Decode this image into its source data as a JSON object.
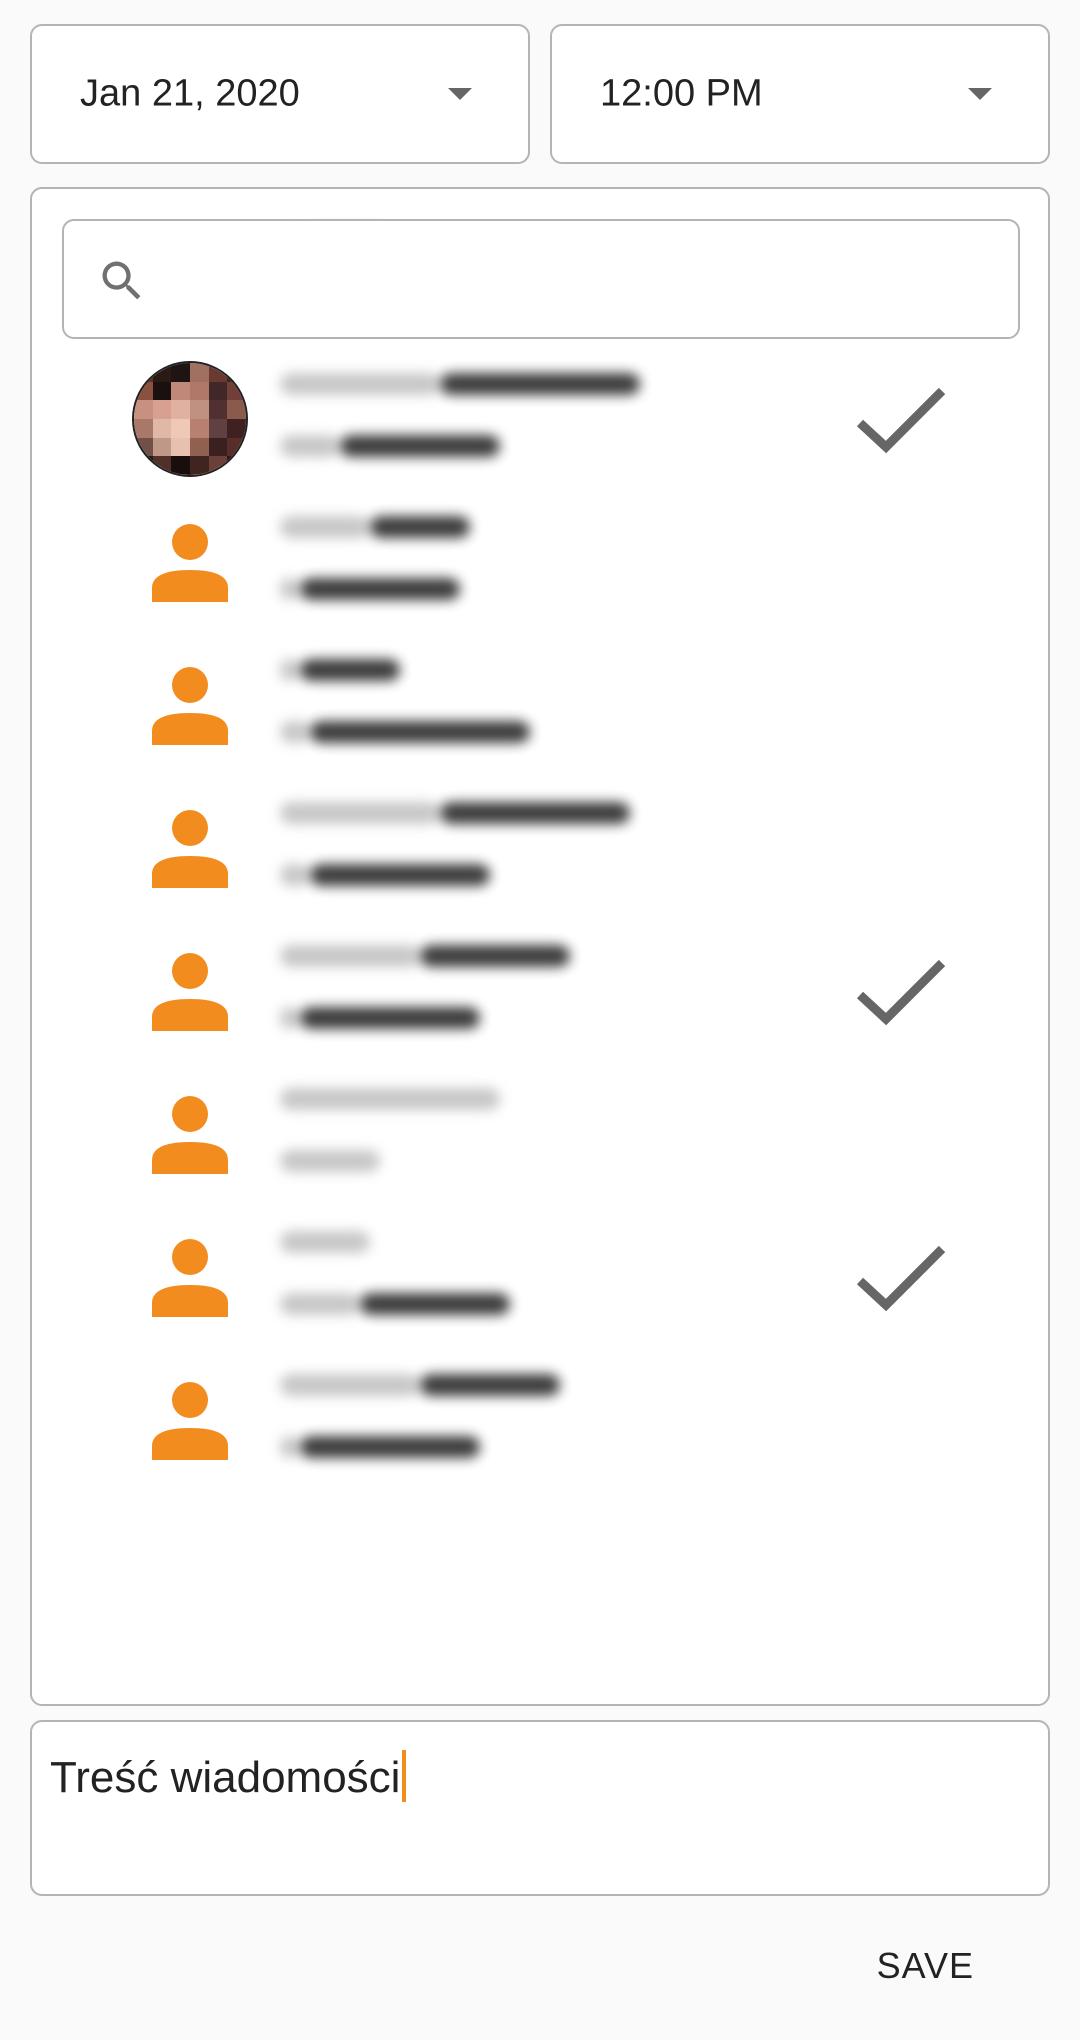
{
  "date_picker": {
    "value": "Jan 21, 2020"
  },
  "time_picker": {
    "value": "12:00 PM"
  },
  "search": {
    "placeholder": ""
  },
  "contacts": [
    {
      "avatar": "person-icon",
      "selected": false
    },
    {
      "avatar": "person-icon",
      "selected": false
    },
    {
      "avatar": "photo",
      "selected": true
    },
    {
      "avatar": "person-icon",
      "selected": false
    },
    {
      "avatar": "person-icon",
      "selected": false
    },
    {
      "avatar": "person-icon",
      "selected": false
    },
    {
      "avatar": "person-icon",
      "selected": true
    },
    {
      "avatar": "person-icon",
      "selected": false
    },
    {
      "avatar": "person-icon",
      "selected": true
    },
    {
      "avatar": "person-icon",
      "selected": false
    }
  ],
  "message": {
    "text": "Treść wiadomości"
  },
  "actions": {
    "save_label": "SAVE"
  },
  "colors": {
    "accent": "#f28c1f",
    "check": "#666666",
    "border": "#b4b4b4"
  }
}
